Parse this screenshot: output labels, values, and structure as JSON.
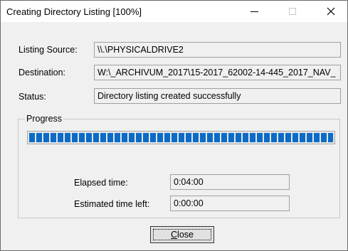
{
  "window": {
    "title": "Creating Directory Listing [100%]",
    "controls": {
      "minimize": "—",
      "maximize": "☐",
      "close": "✕"
    }
  },
  "fields": {
    "source_label": "Listing Source:",
    "source_value": "\\\\.\\PHYSICALDRIVE2",
    "destination_label": "Destination:",
    "destination_value": "W:\\_ARCHIVUM_2017\\15-2017_62002-14-445_2017_NAV_",
    "status_label": "Status:",
    "status_value": "Directory listing created successfully"
  },
  "progress": {
    "group_label": "Progress",
    "fraction": 1.0,
    "bar_color": "#0b6bc8",
    "elapsed_label": "Elapsed time:",
    "elapsed_value": "0:04:00",
    "remaining_label": "Estimated time left:",
    "remaining_value": "0:00:00"
  },
  "buttons": {
    "close_label_underlined": "C",
    "close_label_rest": "lose"
  }
}
